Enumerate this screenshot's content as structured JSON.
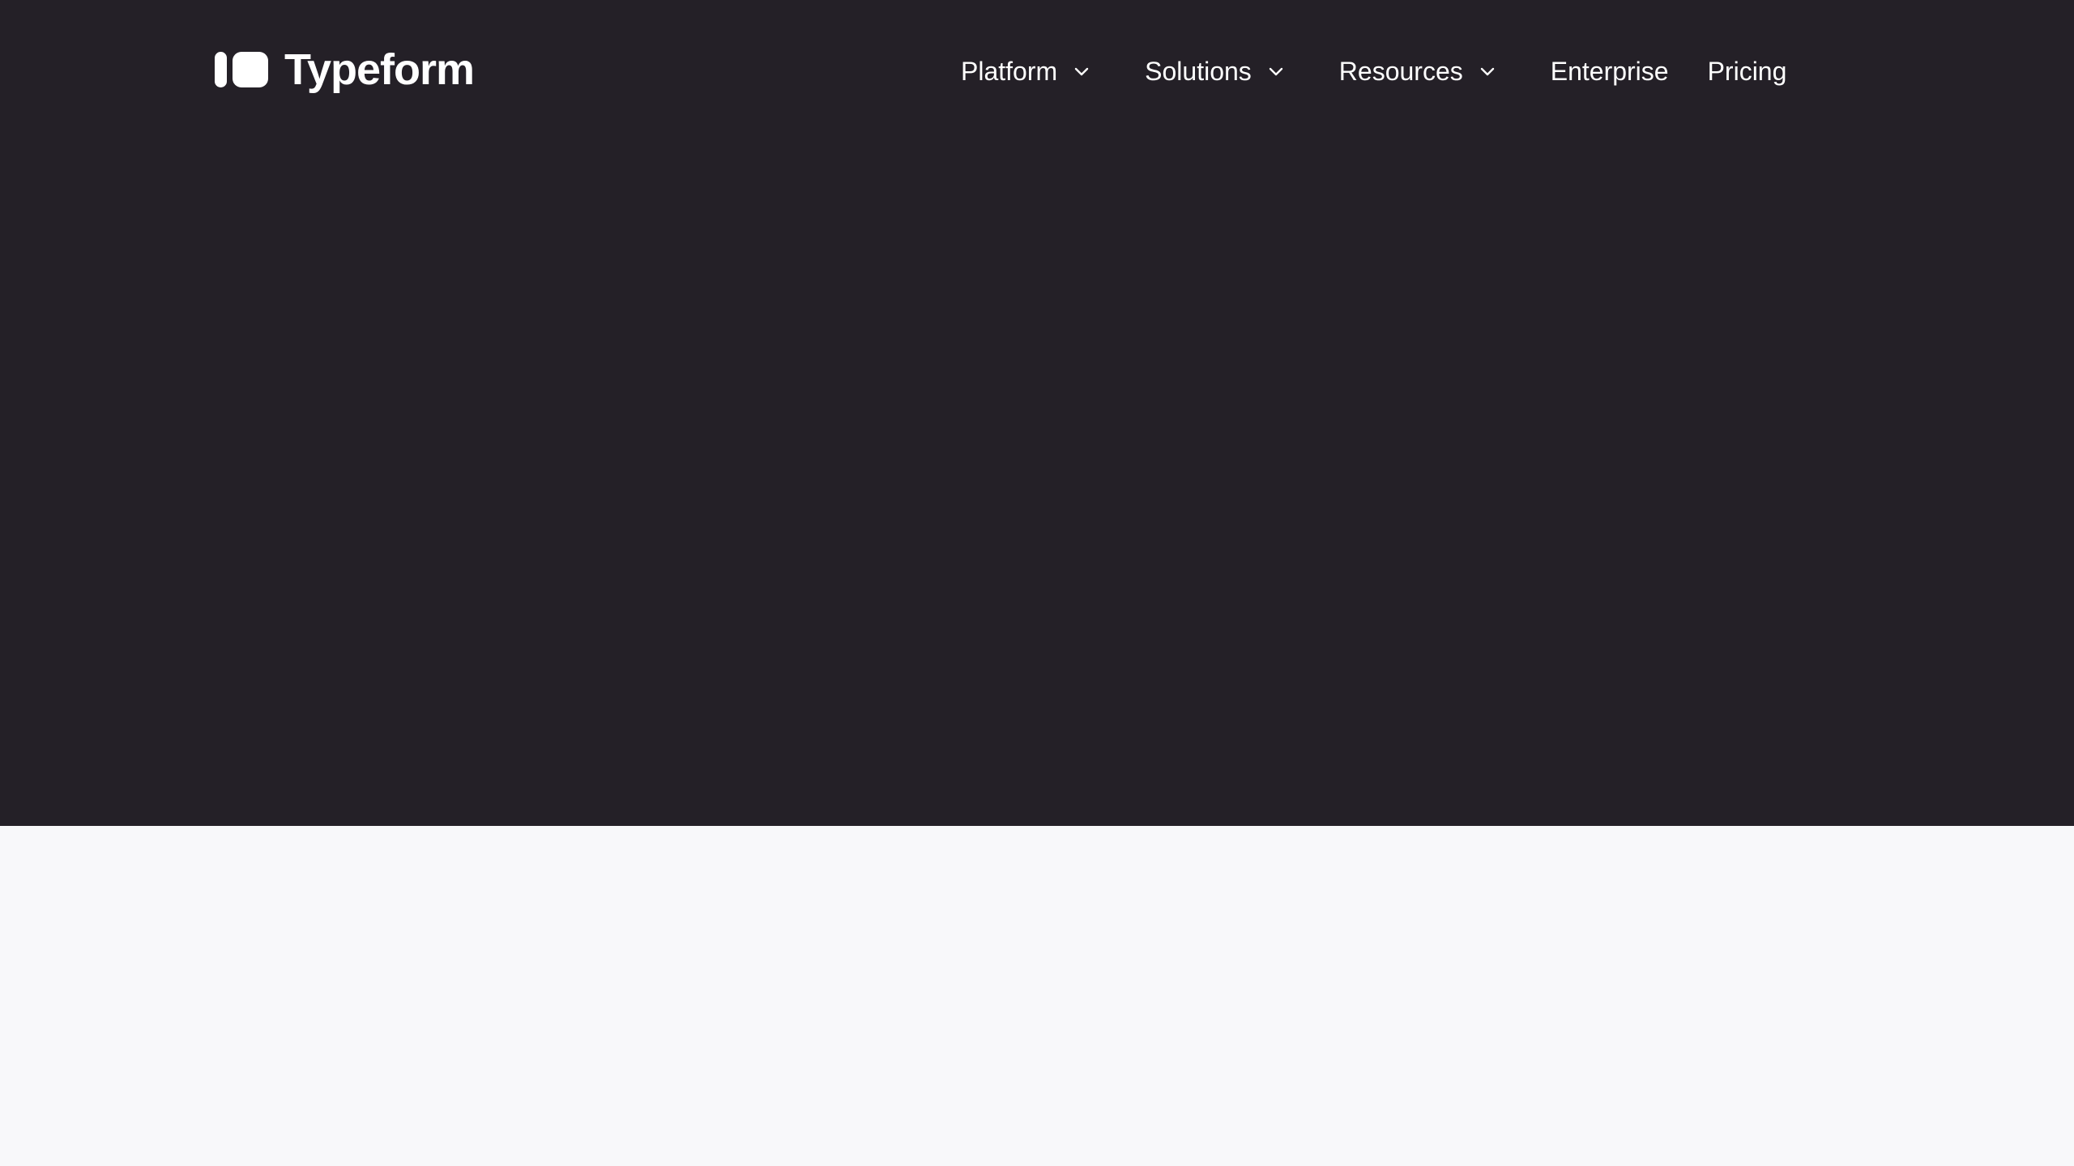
{
  "brand": {
    "name": "Typeform",
    "color": "#FFFFFF"
  },
  "colors": {
    "hero_background": "#242027",
    "page_background": "#F8F8FA",
    "nav_text": "#FFFFFF"
  },
  "nav": {
    "items": [
      {
        "label": "Platform",
        "has_dropdown": true,
        "icon": "chevron-down-icon"
      },
      {
        "label": "Solutions",
        "has_dropdown": true,
        "icon": "chevron-down-icon"
      },
      {
        "label": "Resources",
        "has_dropdown": true,
        "icon": "chevron-down-icon"
      },
      {
        "label": "Enterprise",
        "has_dropdown": false
      },
      {
        "label": "Pricing",
        "has_dropdown": false
      }
    ]
  }
}
